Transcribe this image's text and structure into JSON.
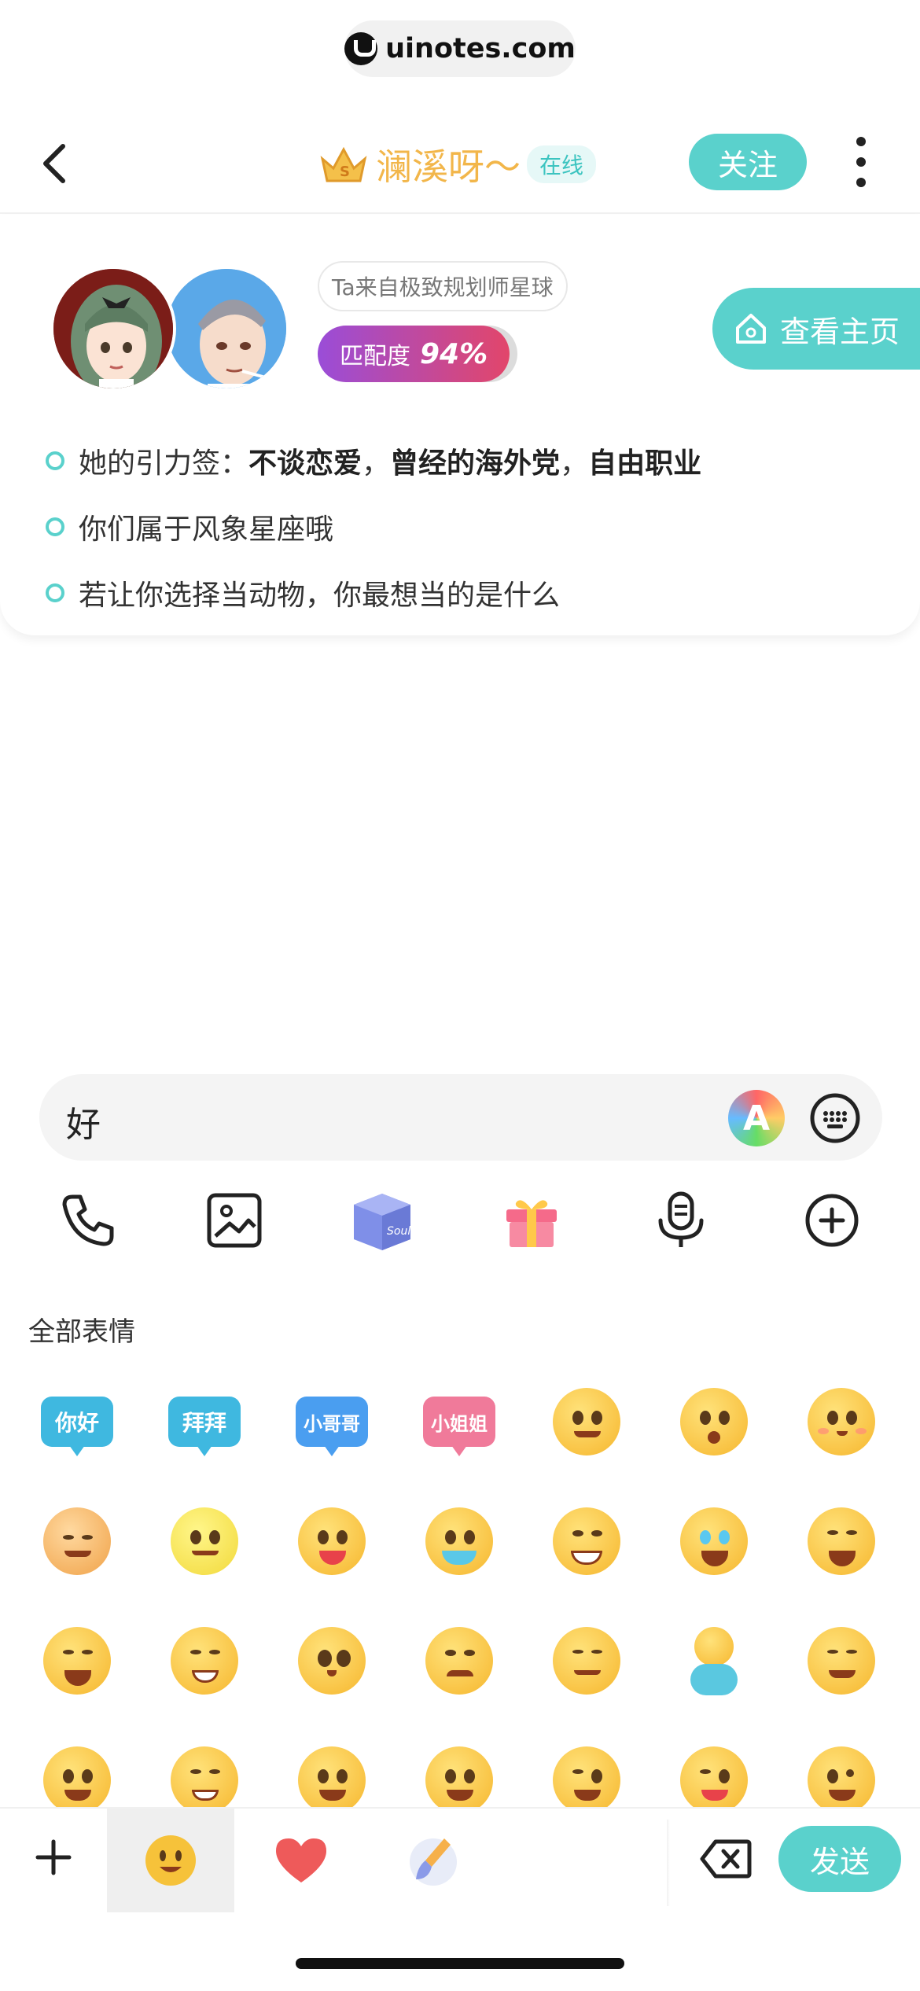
{
  "watermark": {
    "text": "uinotes.com"
  },
  "nav": {
    "title": "澜溪呀～",
    "status": "在线",
    "follow_label": "关注"
  },
  "profile": {
    "planet_tag": "Ta来自极致规划师星球",
    "match_label": "匹配度",
    "match_value": "94%",
    "home_label": "查看主页",
    "bullets": {
      "tags_prefix": "她的引力签：",
      "tag1": "不谈恋爱",
      "sep1": "，",
      "tag2": "曾经的海外党",
      "sep2": "，",
      "tag3": "自由职业",
      "line2": "你们属于风象星座哦",
      "line3": "若让你选择当动物，你最想当的是什么"
    }
  },
  "input": {
    "value": "好",
    "ai_glyph": "A"
  },
  "tools": [
    "phone-icon",
    "image-icon",
    "soul-box-icon",
    "gift-icon",
    "voice-icon",
    "add-icon"
  ],
  "emoji_panel": {
    "title": "全部表情",
    "stickers": [
      {
        "text": "你好",
        "color": "#3fb8e0"
      },
      {
        "text": "拜拜",
        "color": "#3fb8e0"
      },
      {
        "text": "小哥哥",
        "color": "#4a9ef0"
      },
      {
        "text": "小姐姐",
        "color": "#f07a9a"
      }
    ]
  },
  "bottom_bar": {
    "send_label": "发送"
  },
  "colors": {
    "accent": "#5ad1cc",
    "title_gold": "#f2b64a",
    "match_start": "#9a4dd8",
    "match_end": "#e2466a"
  }
}
